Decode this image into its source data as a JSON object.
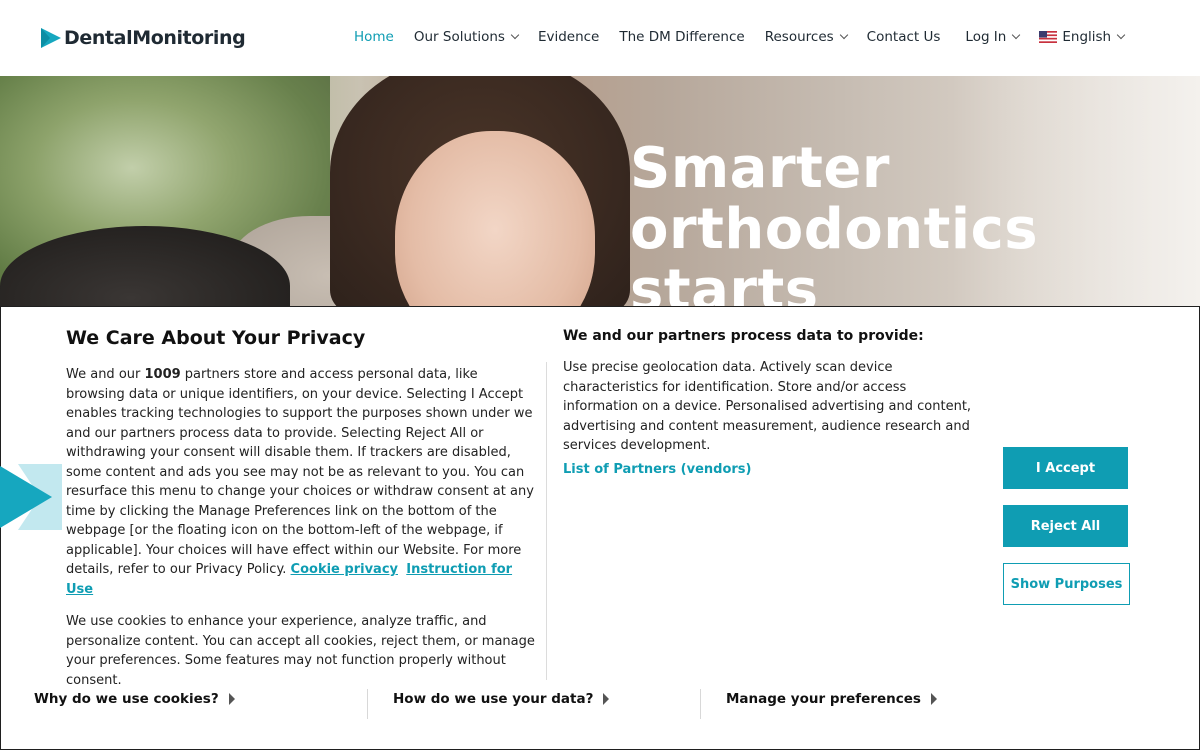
{
  "brand": {
    "name": "DentalMonitoring",
    "accent_color": "#0f9db3"
  },
  "nav": {
    "items": [
      {
        "label": "Home",
        "active": true,
        "dropdown": false
      },
      {
        "label": "Our Solutions",
        "active": false,
        "dropdown": true
      },
      {
        "label": "Evidence",
        "active": false,
        "dropdown": false
      },
      {
        "label": "The DM Difference",
        "active": false,
        "dropdown": false
      },
      {
        "label": "Resources",
        "active": false,
        "dropdown": true
      },
      {
        "label": "Contact Us",
        "active": false,
        "dropdown": false
      },
      {
        "label": "Log In",
        "active": false,
        "dropdown": true
      }
    ],
    "language": {
      "label": "English",
      "flag_icon": "us-flag-icon"
    }
  },
  "hero": {
    "title_line1": "Smarter",
    "title_line2": "orthodontics",
    "title_line3": "starts"
  },
  "cookie": {
    "title": "We Care About Your Privacy",
    "para1_pre": "We and our ",
    "partner_count": "1009",
    "para1_post": " partners store and access personal data, like browsing data or unique identifiers, on your device. Selecting I Accept enables tracking technologies to support the purposes shown under we and our partners process data to provide. Selecting Reject All or withdrawing your consent will disable them. If trackers are disabled, some content and ads you see may not be as relevant to you. You can resurface this menu to change your choices or withdraw consent at any time by clicking the Manage Preferences link on the bottom of the webpage [or the floating icon on the bottom-left of the webpage, if applicable]. Your choices will have effect within our Website. For more details, refer to our Privacy Policy. ",
    "link_cookie_privacy": "Cookie privacy",
    "link_instruction": "Instruction for Use",
    "para2": "We use cookies to enhance your experience, analyze traffic, and personalize content. You can accept all cookies, reject them, or manage your preferences. Some features may not function properly without consent.",
    "mid_title": "We and our partners process data to provide:",
    "mid_text": "Use precise geolocation data. Actively scan device characteristics for identification. Store and/or access information on a device. Personalised advertising and content, advertising and content measurement, audience research and services development.",
    "vendors_link": "List of Partners (vendors)",
    "buttons": {
      "accept": "I Accept",
      "reject": "Reject All",
      "purposes": "Show Purposes"
    },
    "footer": {
      "why": "Why do we use cookies?",
      "how": "How do we use your data?",
      "manage": "Manage your preferences"
    }
  }
}
